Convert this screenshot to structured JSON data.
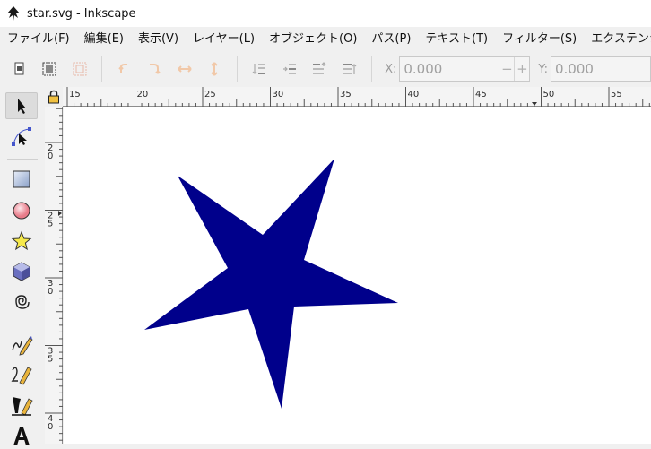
{
  "window": {
    "title": "star.svg - Inkscape",
    "icon": "inkscape-icon"
  },
  "menubar": {
    "items": [
      {
        "label": "ファイル(F)"
      },
      {
        "label": "編集(E)"
      },
      {
        "label": "表示(V)"
      },
      {
        "label": "レイヤー(L)"
      },
      {
        "label": "オブジェクト(O)"
      },
      {
        "label": "パス(P)"
      },
      {
        "label": "テキスト(T)"
      },
      {
        "label": "フィルター(S)"
      },
      {
        "label": "エクステンション(N)"
      }
    ]
  },
  "toolbar": {
    "x_label": "X:",
    "x_value": "0.000",
    "y_label": "Y:",
    "y_value": "0.000",
    "minus": "−",
    "plus": "+"
  },
  "ruler": {
    "horizontal_labels": [
      "15",
      "20",
      "25",
      "30",
      "35",
      "40",
      "45",
      "50",
      "55"
    ],
    "vertical_labels": [
      "2 0",
      "2 5",
      "3 0",
      "3 5",
      "4 0"
    ]
  },
  "colors": {
    "star_fill": "#00008b",
    "canvas_bg": "#ffffff",
    "chrome_bg": "#f0f0f0"
  },
  "tools": [
    {
      "name": "selector-tool-icon"
    },
    {
      "name": "node-tool-icon"
    },
    {
      "name": "rectangle-tool-icon"
    },
    {
      "name": "ellipse-tool-icon"
    },
    {
      "name": "star-tool-icon"
    },
    {
      "name": "3d-box-tool-icon"
    },
    {
      "name": "spiral-tool-icon"
    },
    {
      "name": "pencil-tool-icon"
    },
    {
      "name": "pen-tool-icon"
    },
    {
      "name": "calligraphy-tool-icon"
    },
    {
      "name": "text-tool-icon"
    }
  ]
}
